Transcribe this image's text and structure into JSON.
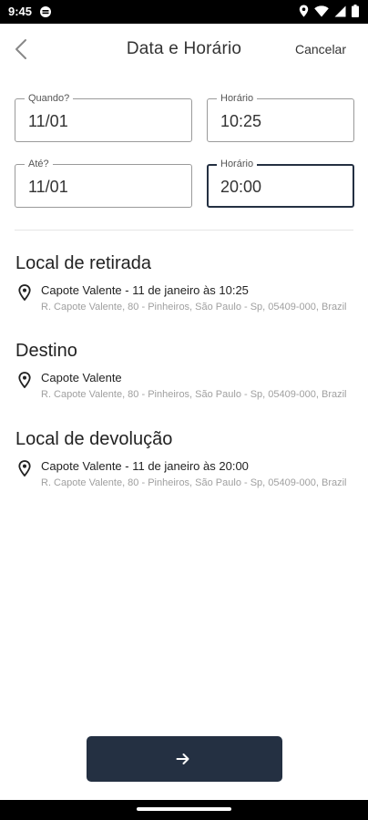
{
  "status": {
    "time": "9:45",
    "icons": [
      "circle-status-icon",
      "location-icon",
      "wifi-icon",
      "signal-icon",
      "battery-icon"
    ]
  },
  "header": {
    "back_icon": "chevron-left-icon",
    "title": "Data e Horário",
    "cancel_label": "Cancelar"
  },
  "form": {
    "start_date": {
      "label": "Quando?",
      "value": "11/01"
    },
    "start_time": {
      "label": "Horário",
      "value": "10:25"
    },
    "end_date": {
      "label": "Até?",
      "value": "11/01"
    },
    "end_time": {
      "label": "Horário",
      "value": "20:00",
      "focused": true
    }
  },
  "sections": {
    "pickup": {
      "title": "Local de retirada",
      "name": "Capote Valente - 11 de janeiro às 10:25",
      "address": "R. Capote Valente, 80 - Pinheiros, São Paulo - Sp, 05409-000, Brazil"
    },
    "destination": {
      "title": "Destino",
      "name": "Capote Valente",
      "address": "R. Capote Valente, 80 - Pinheiros, São Paulo - Sp, 05409-000, Brazil"
    },
    "return": {
      "title": "Local de devolução",
      "name": "Capote Valente - 11 de janeiro às 20:00",
      "address": "R. Capote Valente, 80 - Pinheiros, São Paulo - Sp, 05409-000, Brazil"
    }
  },
  "footer": {
    "next_icon": "arrow-right-icon"
  },
  "colors": {
    "primary": "#243042",
    "secondary_text": "#a0a0a0"
  }
}
